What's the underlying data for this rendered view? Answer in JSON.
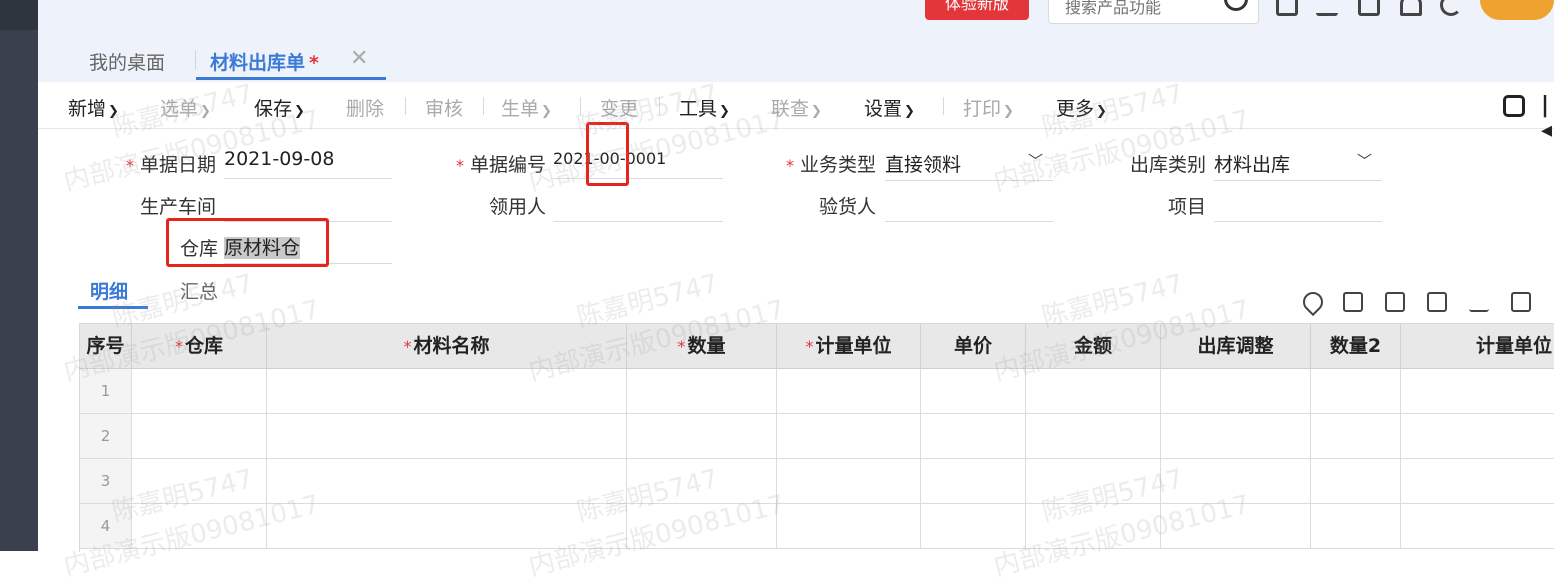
{
  "topbar": {
    "trial_button": "体验新版",
    "search_placeholder": "搜索产品功能"
  },
  "tabs": [
    {
      "label": "我的桌面"
    },
    {
      "label": "材料出库单",
      "modified_mark": "*"
    }
  ],
  "toolbar": [
    {
      "label": "新增",
      "enabled": true,
      "dropdown": true
    },
    {
      "label": "选单",
      "enabled": false,
      "dropdown": true
    },
    {
      "label": "保存",
      "enabled": true,
      "dropdown": true
    },
    {
      "label": "删除",
      "enabled": false
    },
    {
      "label": "审核",
      "enabled": false
    },
    {
      "label": "生单",
      "enabled": false,
      "dropdown": true
    },
    {
      "label": "变更",
      "enabled": false
    },
    {
      "label": "工具",
      "enabled": true,
      "dropdown": true
    },
    {
      "label": "联查",
      "enabled": false,
      "dropdown": true
    },
    {
      "label": "设置",
      "enabled": true,
      "dropdown": true
    },
    {
      "label": "打印",
      "enabled": false,
      "dropdown": true
    },
    {
      "label": "更多",
      "enabled": true,
      "dropdown": true
    }
  ],
  "form": {
    "required_mark": "*",
    "doc_date": {
      "label": "单据日期",
      "value": "2021-09-08"
    },
    "doc_no": {
      "label": "单据编号",
      "value": "2021-00-0001"
    },
    "biz_type": {
      "label": "业务类型",
      "value": "直接领料"
    },
    "out_type": {
      "label": "出库类别",
      "value": "材料出库"
    },
    "workshop": {
      "label": "生产车间",
      "value": ""
    },
    "receiver": {
      "label": "领用人",
      "value": ""
    },
    "inspector": {
      "label": "验货人",
      "value": ""
    },
    "project": {
      "label": "项目",
      "value": ""
    },
    "warehouse": {
      "label": "仓库",
      "value": "原材料仓"
    }
  },
  "subtabs": {
    "detail": "明细",
    "summary": "汇总"
  },
  "grid": {
    "columns": [
      {
        "label": "序号",
        "required": false
      },
      {
        "label": "仓库",
        "required": true
      },
      {
        "label": "材料名称",
        "required": true
      },
      {
        "label": "数量",
        "required": true
      },
      {
        "label": "计量单位",
        "required": true
      },
      {
        "label": "单价",
        "required": false
      },
      {
        "label": "金额",
        "required": false
      },
      {
        "label": "出库调整",
        "required": false
      },
      {
        "label": "数量2",
        "required": false
      },
      {
        "label": "计量单位",
        "required": false
      }
    ],
    "rows": [
      "1",
      "2",
      "3",
      "4"
    ]
  },
  "watermark": {
    "name": "陈嘉明5747",
    "edition": "内部演示版09081017"
  },
  "colors": {
    "accent": "#3b7bd6",
    "danger": "#e2363a",
    "annotation": "#e8231c"
  }
}
